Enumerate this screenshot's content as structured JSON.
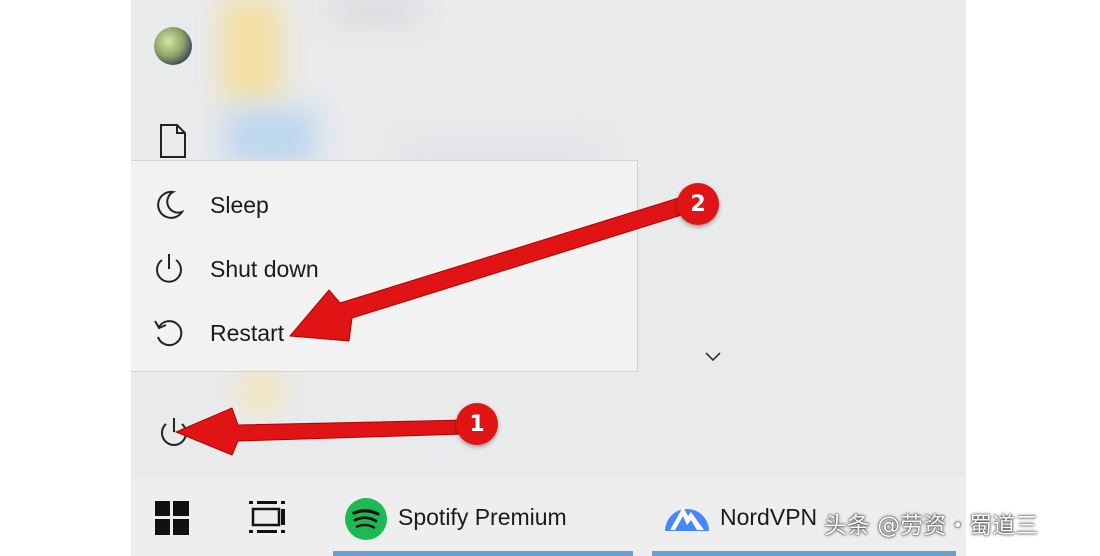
{
  "power_menu": {
    "items": [
      {
        "label": "Sleep",
        "icon": "moon-icon"
      },
      {
        "label": "Shut down",
        "icon": "power-icon"
      },
      {
        "label": "Restart",
        "icon": "restart-icon"
      }
    ]
  },
  "start_left_rail": {
    "icons": [
      "avatar",
      "document-icon",
      "power-icon"
    ]
  },
  "taskbar": {
    "items": [
      {
        "icon": "windows-logo-icon"
      },
      {
        "icon": "task-view-icon"
      },
      {
        "label": "Spotify Premium",
        "icon": "spotify-icon"
      },
      {
        "label": "NordVPN",
        "icon": "nordvpn-icon"
      }
    ]
  },
  "annotations": {
    "step1": "1",
    "step2": "2"
  },
  "watermark": "头条 @劳资・蜀道三",
  "colors": {
    "annotation_red": "#e01414",
    "spotify_green": "#1db954",
    "nordvpn_blue": "#4687ff",
    "taskbar_active": "#6a9fd2"
  }
}
